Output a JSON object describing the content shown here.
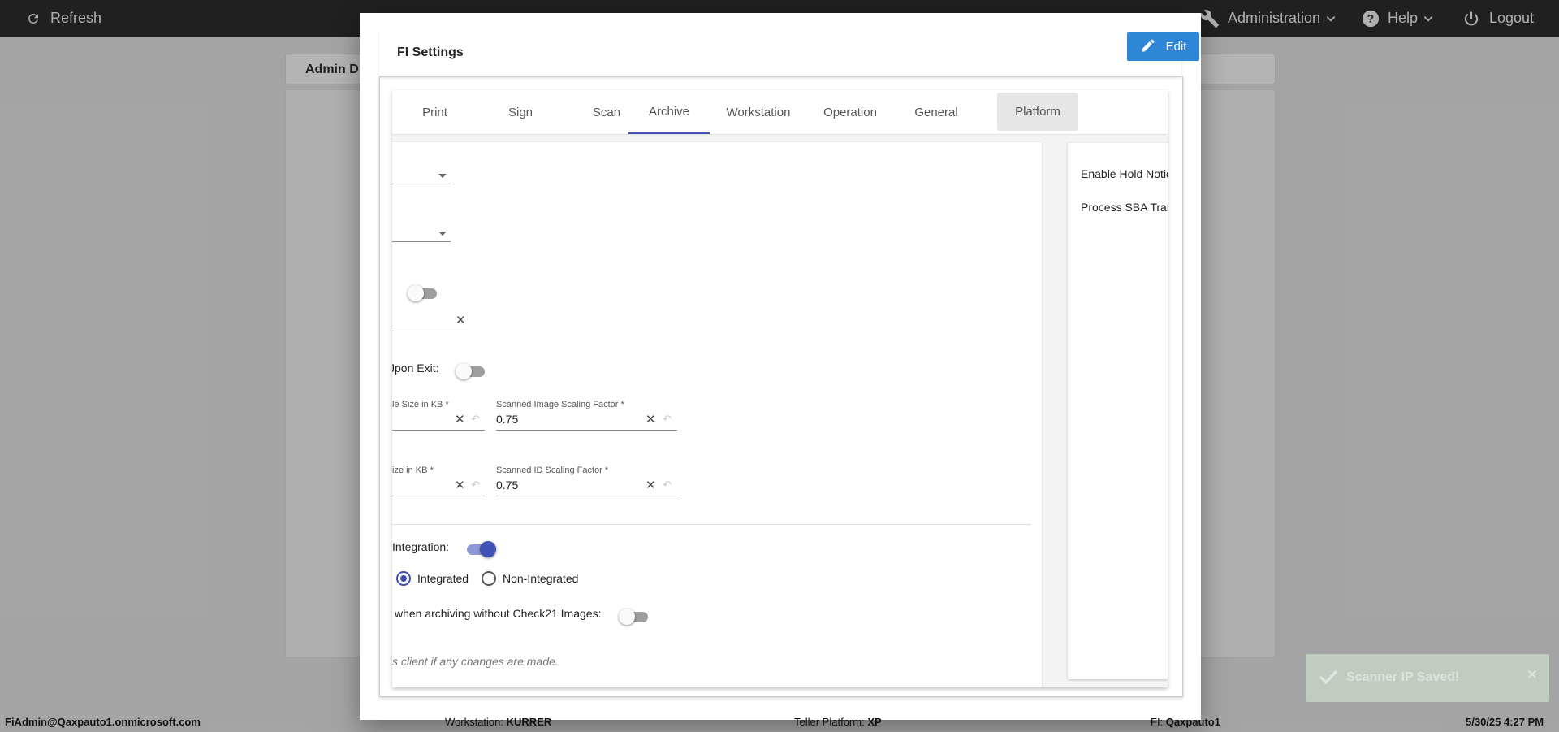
{
  "topbar": {
    "refresh_label": "Refresh",
    "administration_label": "Administration",
    "help_label": "Help",
    "logout_label": "Logout"
  },
  "background": {
    "tab_label": "Admin D"
  },
  "modal": {
    "title": "FI Settings",
    "edit_label": "Edit",
    "tabs": [
      {
        "label": "Print"
      },
      {
        "label": "Sign"
      },
      {
        "label": "Scan"
      },
      {
        "label": "Archive"
      },
      {
        "label": "Workstation"
      },
      {
        "label": "Operation"
      },
      {
        "label": "General"
      },
      {
        "label": "Platform"
      }
    ],
    "active_tab": "Archive",
    "fields": {
      "exit_label": "Jpon Exit:",
      "image_size_label": "le Size in KB *",
      "image_scaling_label": "Scanned Image Scaling Factor *",
      "image_scaling_value": "0.75",
      "id_size_label": "ize in KB *",
      "id_scaling_label": "Scanned ID Scaling Factor *",
      "id_scaling_value": "0.75",
      "integration_label": "Integration:",
      "radio_integrated": "Integrated",
      "radio_non_integrated": "Non-Integrated",
      "check21_label": "when archiving without Check21 Images:",
      "note": "s client if any changes are made."
    },
    "right_pane": {
      "item1": "Enable Hold Notic",
      "item2": "Process SBA Tran"
    }
  },
  "toast": {
    "message": "Scanner IP Saved!"
  },
  "footer": {
    "user": "FiAdmin@Qaxpauto1.onmicrosoft.com",
    "workstation_label": "Workstation:",
    "workstation_value": "KURRER",
    "teller_label": "Teller Platform:",
    "teller_value": "XP",
    "fi_label": "FI:",
    "fi_value": "Qaxpauto1",
    "datetime": "5/30/25 4:27 PM"
  },
  "colors": {
    "accent": "#3f51b5",
    "edit_button": "#2f86d6",
    "topbar": "#131313"
  }
}
